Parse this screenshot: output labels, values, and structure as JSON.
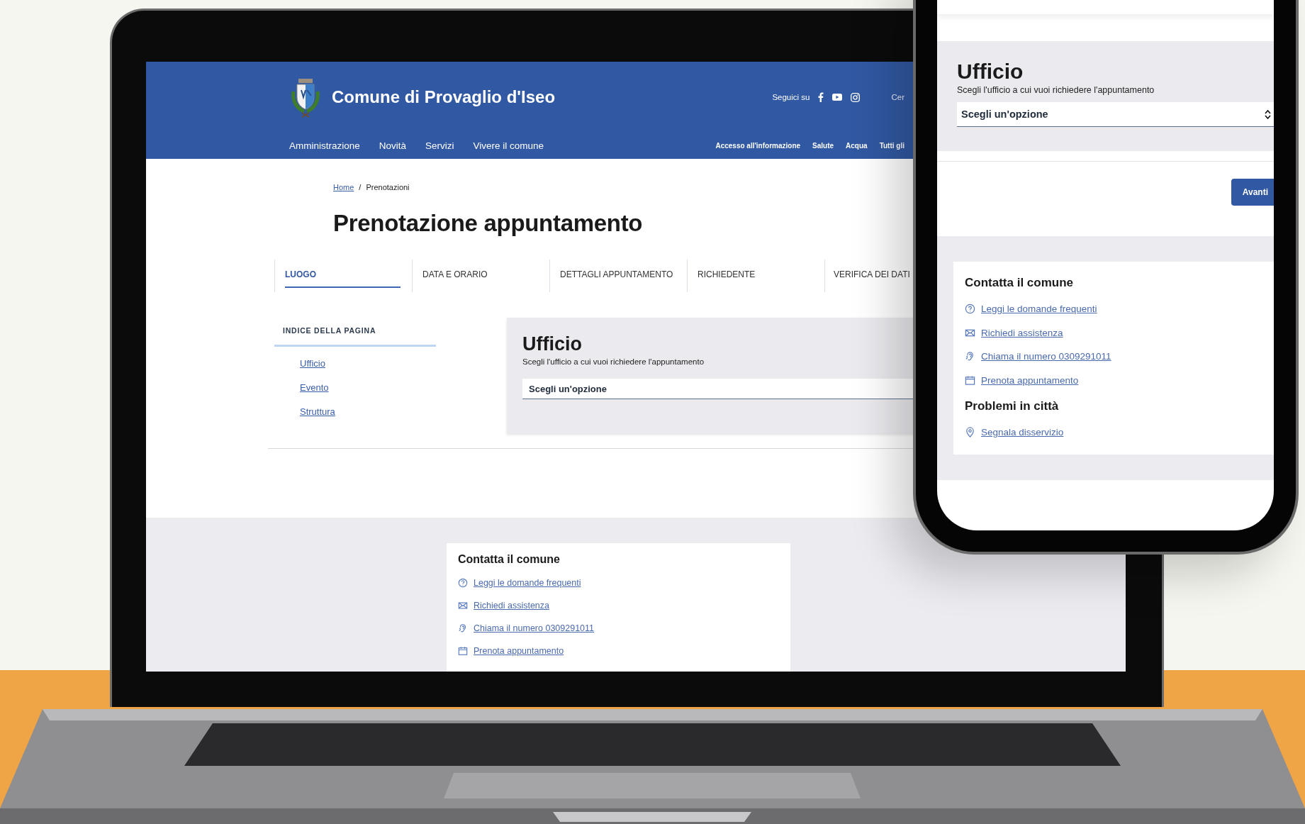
{
  "laptop": {
    "header": {
      "site_name": "Comune di Provaglio d'Iseo",
      "follow_label": "Seguici su",
      "search_label": "Cer",
      "main_nav": [
        "Amministrazione",
        "Novità",
        "Servizi",
        "Vivere il comune"
      ],
      "secondary_nav": [
        "Accesso all'informazione",
        "Salute",
        "Acqua",
        "Tutti gli"
      ]
    },
    "breadcrumb": {
      "separator": "/",
      "items": [
        {
          "label": "Home",
          "kind": "link"
        },
        {
          "label": "Prenotazioni",
          "kind": "current"
        }
      ]
    },
    "page_title": "Prenotazione appuntamento",
    "steps": [
      {
        "label": "LUOGO",
        "selected": true
      },
      {
        "label": "DATA E ORARIO",
        "selected": false
      },
      {
        "label": "DETTAGLI APPUNTAMENTO",
        "selected": false
      },
      {
        "label": "RICHIEDENTE",
        "selected": false
      },
      {
        "label": "VERIFICA DEI DATI",
        "selected": false
      }
    ],
    "page_index": {
      "title": "INDICE DELLA PAGINA",
      "items": [
        "Ufficio",
        "Evento",
        "Struttura"
      ]
    },
    "office": {
      "title": "Ufficio",
      "description": "Scegli l'ufficio a cui vuoi richiedere l'appuntamento",
      "select": {
        "value": "Scegli un'opzione"
      }
    },
    "contacts": {
      "title": "Contatta il comune",
      "links": [
        {
          "label": "Leggi le domande frequenti",
          "kind": "faq"
        },
        {
          "label": "Richiedi assistenza",
          "kind": "assistance"
        },
        {
          "label": "Chiama il numero 0309291011",
          "kind": "call"
        },
        {
          "label": "Prenota appuntamento",
          "kind": "booking"
        }
      ]
    }
  },
  "phone": {
    "office": {
      "title": "Ufficio",
      "description": "Scegli l'ufficio a cui vuoi richiedere l'appuntamento",
      "select": {
        "value": "Scegli un'opzione"
      }
    },
    "next_button": "Avanti",
    "contacts": {
      "title": "Contatta il comune",
      "links": [
        {
          "label": "Leggi le domande frequenti",
          "kind": "faq"
        },
        {
          "label": "Richiedi assistenza",
          "kind": "assistance"
        },
        {
          "label": "Chiama il numero 0309291011",
          "kind": "call"
        },
        {
          "label": "Prenota appuntamento",
          "kind": "booking"
        }
      ]
    },
    "problems": {
      "title": "Problemi in città",
      "links": [
        {
          "label": "Segnala disservizio",
          "kind": "report"
        }
      ]
    }
  }
}
